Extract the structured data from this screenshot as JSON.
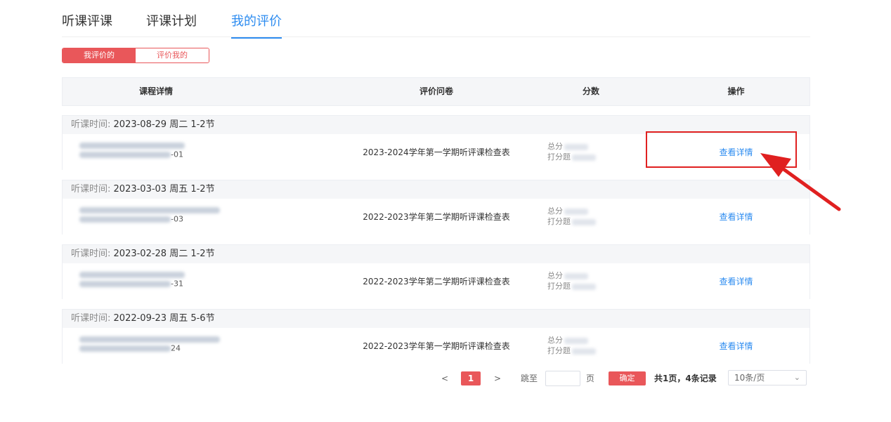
{
  "tabs": [
    {
      "label": "听课评课"
    },
    {
      "label": "评课计划"
    },
    {
      "label": "我的评价"
    }
  ],
  "segment": {
    "mine": "我评价的",
    "others": "评价我的"
  },
  "table": {
    "headers": {
      "course": "课程详情",
      "paper": "评价问卷",
      "score": "分数",
      "action": "操作"
    },
    "time_label": "听课时间:",
    "rows": [
      {
        "time": "2023-08-29 周二 1-2节",
        "code_suffix": "-01",
        "paper": "2023-2024学年第一学期听评课检查表",
        "total_label": "总分",
        "score_label": "打分题",
        "action": "查看详情"
      },
      {
        "time": "2023-03-03 周五 1-2节",
        "code_suffix": "-03",
        "paper": "2022-2023学年第二学期听评课检查表",
        "total_label": "总分",
        "score_label": "打分题",
        "action": "查看详情"
      },
      {
        "time": "2023-02-28 周二 1-2节",
        "code_suffix": "-31",
        "paper": "2022-2023学年第二学期听评课检查表",
        "total_label": "总分",
        "score_label": "打分题",
        "action": "查看详情"
      },
      {
        "time": "2022-09-23 周五 5-6节",
        "code_suffix": "24",
        "paper": "2022-2023学年第一学期听评课检查表",
        "total_label": "总分",
        "score_label": "打分题",
        "action": "查看详情"
      }
    ]
  },
  "pagination": {
    "prev": "<",
    "current": "1",
    "next": ">",
    "jump_label": "跳至",
    "page_unit": "页",
    "confirm": "确定",
    "summary": "共1页，4条记录",
    "page_size": "10条/页"
  },
  "colors": {
    "accent": "#e9575a",
    "link": "#2d8cf0",
    "highlight": "#e02020"
  }
}
